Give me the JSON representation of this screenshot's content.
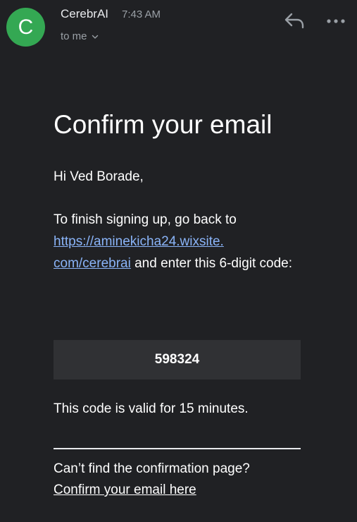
{
  "header": {
    "avatar_letter": "C",
    "avatar_color": "#34a853",
    "sender": "CerebrAI",
    "time": "7:43 AM",
    "recipient": "to me",
    "reply_icon": "reply-icon",
    "more_icon": "more-horizontal-icon"
  },
  "email": {
    "title": "Confirm your email",
    "greeting": "Hi Ved Borade,",
    "instructions_before": "To finish signing up, go back to ",
    "link_line1": "https://aminekicha24.wixsite.",
    "link_line2": "com/cerebrai",
    "instructions_after": " and enter this 6-digit code:",
    "code": "598324",
    "validity": "This code is valid for 15 minutes.",
    "help_text": "Can’t find the confirmation page?",
    "help_link": "Confirm your email here"
  },
  "colors": {
    "background": "#202124",
    "code_box": "#303134",
    "link": "#8ab4f8"
  }
}
